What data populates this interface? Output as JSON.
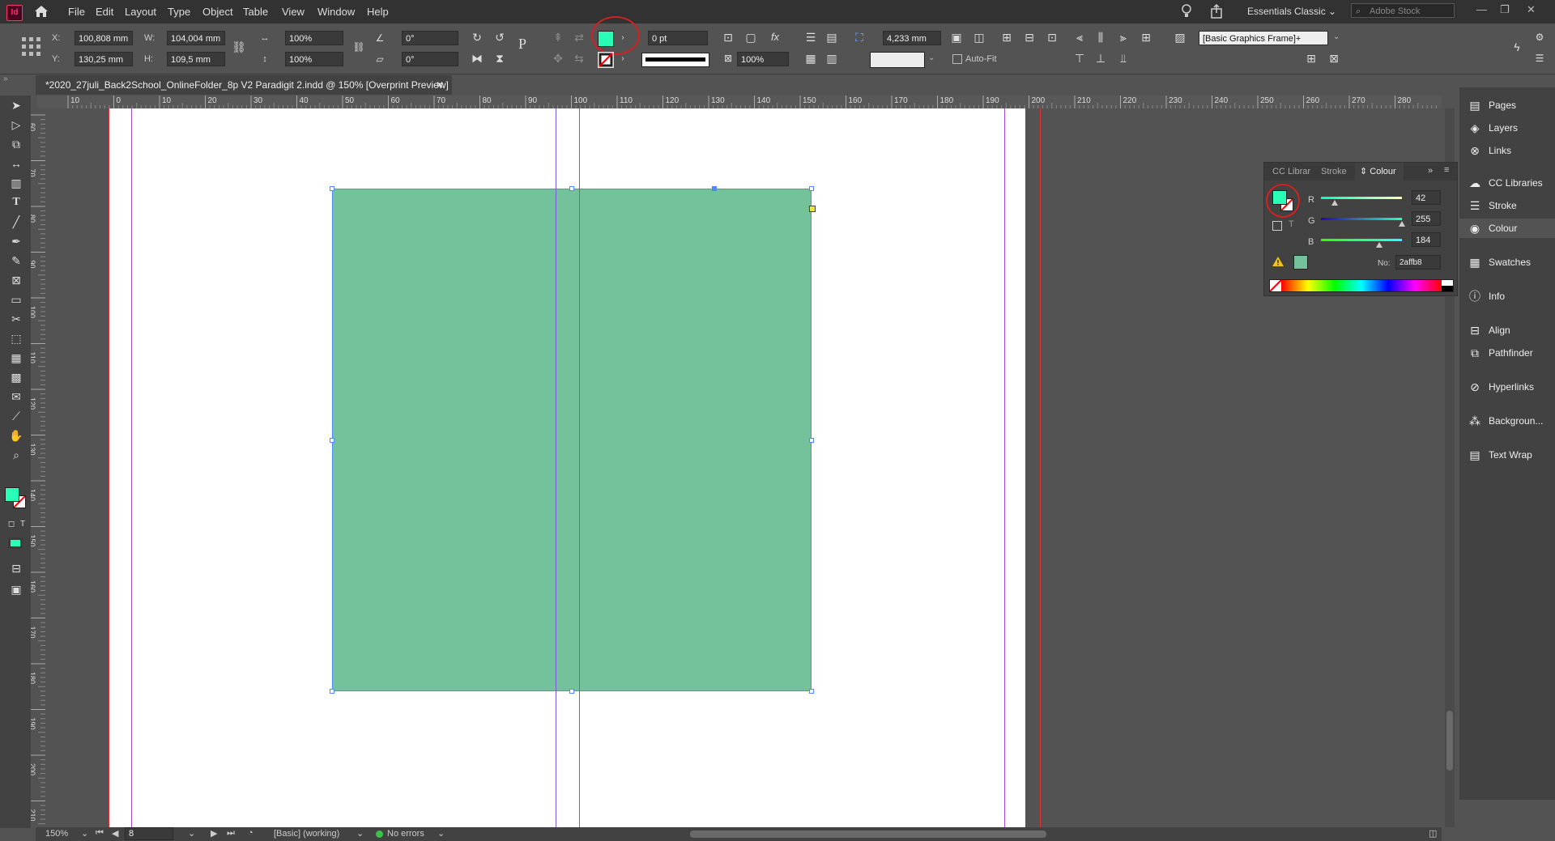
{
  "app": {
    "icon_text": "Id"
  },
  "menu": [
    "File",
    "Edit",
    "Layout",
    "Type",
    "Object",
    "Table",
    "View",
    "Window",
    "Help"
  ],
  "workspace": {
    "label": "Essentials Classic",
    "stock_placeholder": "Adobe Stock"
  },
  "control": {
    "x_label": "X:",
    "x_value": "100,808 mm",
    "y_label": "Y:",
    "y_value": "130,25 mm",
    "w_label": "W:",
    "w_value": "104,004 mm",
    "h_label": "H:",
    "h_value": "109,5 mm",
    "scale_x": "100%",
    "scale_y": "100%",
    "rotate": "0°",
    "shear": "0°",
    "stroke_weight": "0 pt",
    "opacity": "100%",
    "corner": "4,233 mm",
    "object_style": "[Basic Graphics Frame]+",
    "autofit_label": "Auto-Fit",
    "fill_color": "#2affb8"
  },
  "document": {
    "tab_title": "*2020_27juli_Back2School_OnlineFolder_8p V2 Paradigit 2.indd @ 150% [Overprint Preview]"
  },
  "ruler": {
    "h_ticks": [
      "10",
      "0",
      "10",
      "20",
      "30",
      "40",
      "50",
      "60",
      "70",
      "80",
      "90",
      "100",
      "110",
      "120",
      "130",
      "140",
      "150",
      "160",
      "170",
      "180",
      "190",
      "200",
      "210",
      "220",
      "230",
      "240",
      "250",
      "260",
      "270",
      "280"
    ],
    "v_ticks": [
      "60",
      "70",
      "80",
      "90",
      "100",
      "110",
      "120",
      "130",
      "140",
      "150",
      "160",
      "170",
      "180",
      "190",
      "200",
      "210"
    ]
  },
  "canvas": {
    "frame_color": "#74c29c"
  },
  "dock": [
    "Pages",
    "Layers",
    "Links",
    "CC Libraries",
    "Stroke",
    "Colour",
    "Swatches",
    "Info",
    "Align",
    "Pathfinder",
    "Hyperlinks",
    "Backgroun...",
    "Text Wrap"
  ],
  "colour_panel": {
    "tabs": [
      "CC Librar",
      "Stroke",
      "Colour"
    ],
    "r_label": "R",
    "r_value": "42",
    "r_fraction": 0.165,
    "g_label": "G",
    "g_value": "255",
    "g_fraction": 1.0,
    "b_label": "B",
    "b_value": "184",
    "b_fraction": 0.72,
    "hex_label": "No:",
    "hex_value": "2affb8",
    "gamut_swatch": "#74c29c"
  },
  "status": {
    "zoom": "150%",
    "page": "8",
    "style": "[Basic] (working)",
    "errors": "No errors"
  }
}
